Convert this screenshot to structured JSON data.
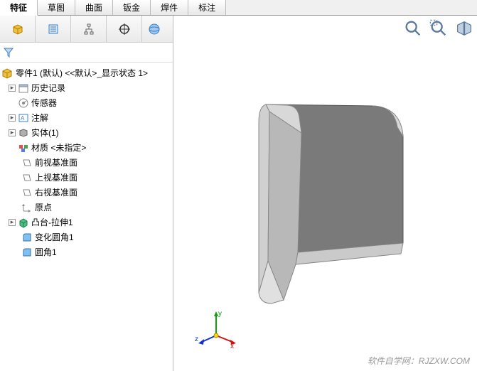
{
  "tabs": {
    "t0": "特征",
    "t1": "草图",
    "t2": "曲面",
    "t3": "钣金",
    "t4": "焊件",
    "t5": "标注"
  },
  "tree": {
    "root": "零件1 (默认) <<默认>_显示状态 1>",
    "history": "历史记录",
    "sensors": "传感器",
    "annotations": "注解",
    "solid": "实体(1)",
    "material": "材质 <未指定>",
    "frontPlane": "前视基准面",
    "topPlane": "上视基准面",
    "rightPlane": "右视基准面",
    "origin": "原点",
    "bossExtrude": "凸台-拉伸1",
    "varFillet": "变化圆角1",
    "fillet": "圆角1"
  },
  "triad": {
    "x": "x",
    "y": "y",
    "z": "z"
  },
  "watermark": "软件自学网：RJZXW.COM"
}
